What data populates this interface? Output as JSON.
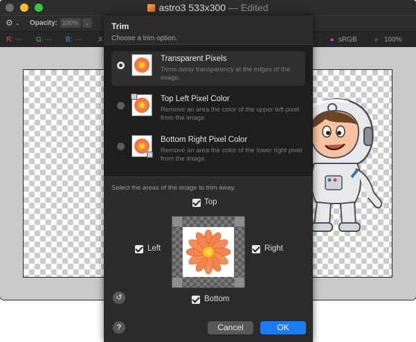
{
  "window": {
    "title": "astro3 533x300",
    "edited_suffix": "— Edited"
  },
  "toolbar": {
    "opacity_label": "Opacity:",
    "opacity_value": "100%"
  },
  "infobar": {
    "r_label": "R:",
    "r_value": "---",
    "g_label": "G:",
    "g_value": "---",
    "b_label": "B:",
    "b_value": "---",
    "x_label": "X",
    "color_profile": "sRGB",
    "zoom": "100%",
    "colors": {
      "r": "#d9534f",
      "g": "#5cb85c",
      "b": "#4a90e2"
    }
  },
  "sheet": {
    "title": "Trim",
    "subtitle": "Choose a trim option.",
    "options": [
      {
        "title": "Transparent Pixels",
        "description": "Trims away transparency at the edges of the image.",
        "selected": true
      },
      {
        "title": "Top Left Pixel Color",
        "description": "Remove an area the color of the upper left pixel from the image.",
        "selected": false
      },
      {
        "title": "Bottom Right Pixel Color",
        "description": "Remove an area the color of the lower right pixel from the image.",
        "selected": false
      }
    ],
    "areas_label": "Select the areas of the image to trim away.",
    "checkboxes": {
      "top": "Top",
      "left": "Left",
      "right": "Right",
      "bottom": "Bottom"
    },
    "cancel_label": "Cancel",
    "ok_label": "OK",
    "help_label": "?",
    "reset_label": "↺"
  },
  "icons": [
    "gear-icon",
    "chevron-down-icon",
    "document-icon",
    "reset-icon",
    "help-icon"
  ],
  "accent_color": "#1d7cf2"
}
